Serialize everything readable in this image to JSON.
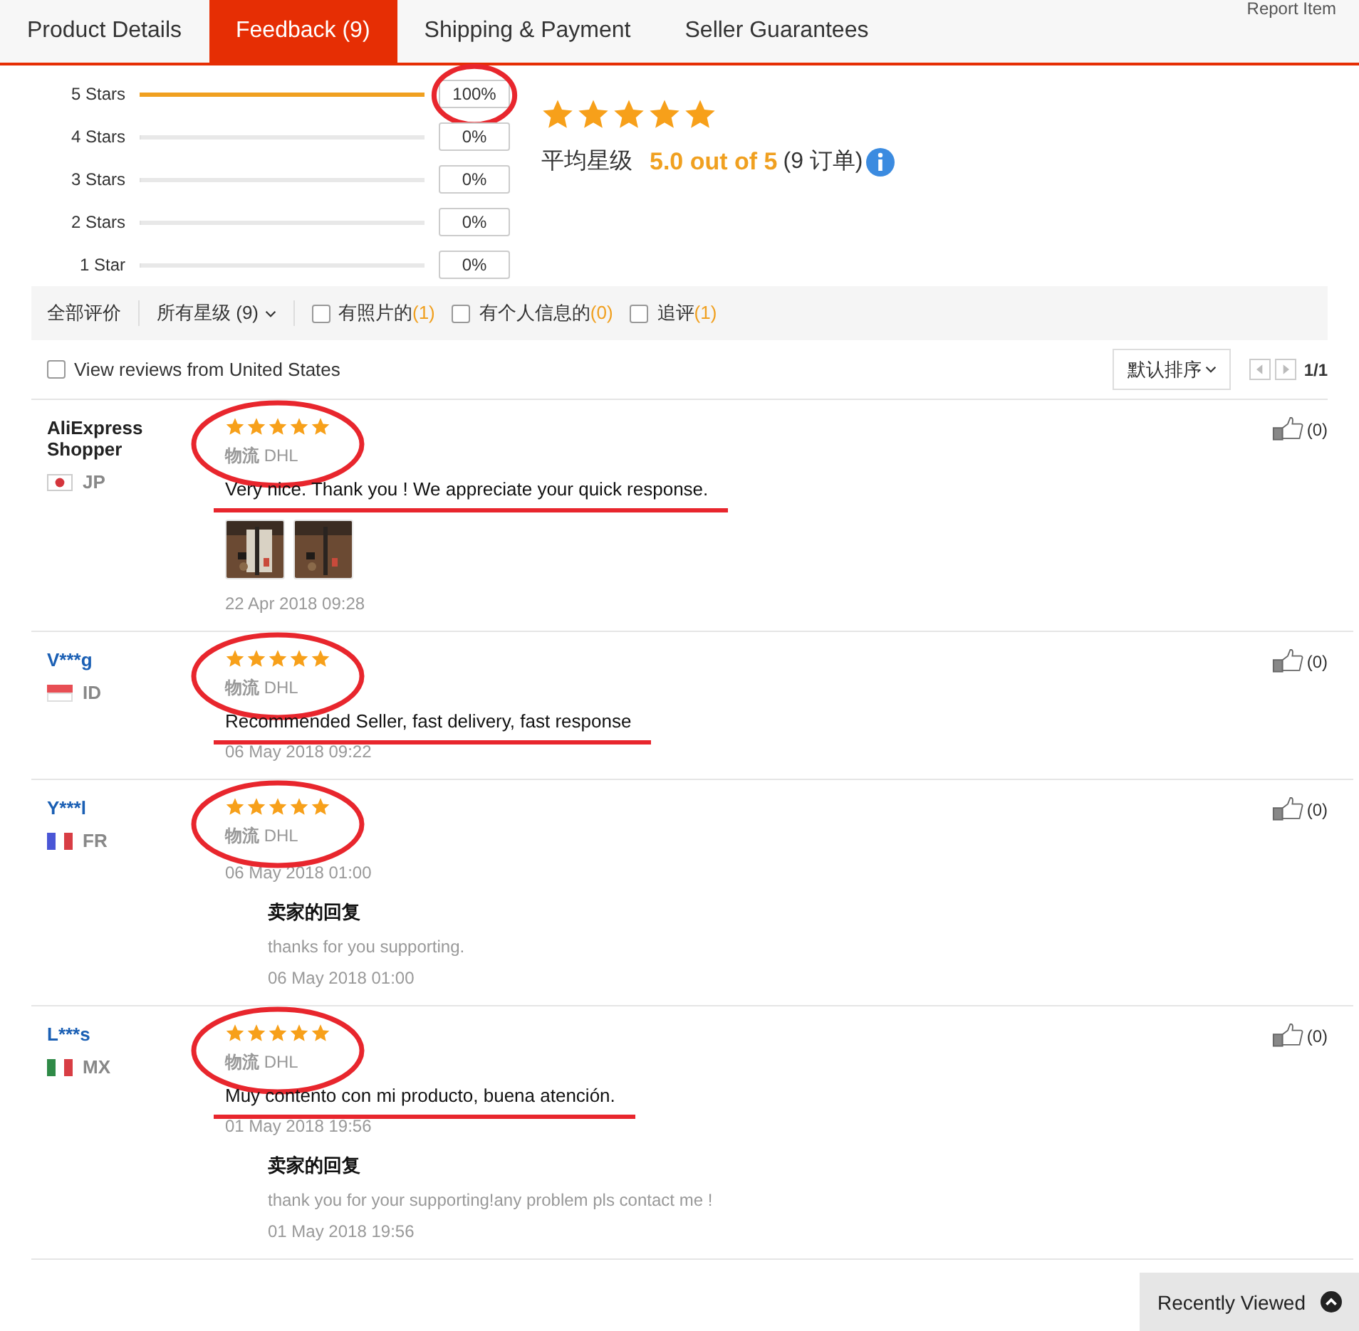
{
  "tabs": [
    {
      "label": "Product Details",
      "selected": false
    },
    {
      "label": "Feedback (9)",
      "selected": true
    },
    {
      "label": "Shipping & Payment",
      "selected": false
    },
    {
      "label": "Seller Guarantees",
      "selected": false
    }
  ],
  "report_link": "Report Item",
  "rating_breakdown": [
    {
      "label": "5 Stars",
      "level": 1,
      "percent": "100%",
      "annotated": true
    },
    {
      "label": "4 Stars",
      "level": 0,
      "percent": "0%",
      "annotated": false
    },
    {
      "label": "3 Stars",
      "level": 0,
      "percent": "0%",
      "annotated": false
    },
    {
      "label": "2 Stars",
      "level": 0,
      "percent": "0%",
      "annotated": false
    },
    {
      "label": "1 Star",
      "level": 0,
      "percent": "0%",
      "annotated": false
    }
  ],
  "summary": {
    "stars": 5,
    "label": "平均星级",
    "score": "5.0 out of 5",
    "orders": "(9 订单)"
  },
  "filters": [
    {
      "kind": "label",
      "text": "全部评价"
    },
    {
      "kind": "dropdown",
      "text": "所有星级 (9)"
    },
    {
      "kind": "checkbox",
      "text": "有照片的",
      "count": "(1)",
      "checked": false
    },
    {
      "kind": "checkbox",
      "text": "有个人信息的",
      "count": "(0)",
      "checked": false
    },
    {
      "kind": "checkbox",
      "text": "追评",
      "count": "(1)",
      "checked": false
    }
  ],
  "country_filter": {
    "label": "View reviews from United States",
    "checked": false
  },
  "sort": "默认排序",
  "pagination": "1/1",
  "reviews": [
    {
      "kind": "anonymous",
      "name": "AliExpress Shopper",
      "flag": {
        "kind": "disc",
        "color": "#d4353c"
      },
      "country": "JP",
      "stars": 5,
      "logistics_label": "物流",
      "logistics": "DHL",
      "text": "Very nice. Thank you ! We appreciate your quick response.",
      "photos": [
        {
          "kind": "picture"
        },
        {
          "kind": "picture"
        }
      ],
      "date": "22 Apr 2018 09:28",
      "likes": "(0)",
      "annotated": true
    },
    {
      "kind": "buyer",
      "name": "V***g",
      "flag": {
        "kind": "bands",
        "color": "#e84e54"
      },
      "country": "ID",
      "stars": 5,
      "logistics_label": "物流",
      "logistics": "DHL",
      "text": "Recommended Seller, fast delivery, fast response",
      "date": "06 May 2018 09:22",
      "likes": "(0)",
      "annotated": true
    },
    {
      "kind": "buyer",
      "name": "Y***l",
      "flag": {
        "kind": "stripes",
        "color": "#4a56d6"
      },
      "country": "FR",
      "stars": 5,
      "logistics_label": "物流",
      "logistics": "DHL",
      "date": "06 May 2018 01:00",
      "likes": "(0)",
      "annotated": true,
      "reply": {
        "title": "卖家的回复",
        "text": "thanks for you supporting.",
        "date": "06 May 2018 01:00"
      }
    },
    {
      "kind": "buyer",
      "name": "L***s",
      "flag": {
        "kind": "stripes",
        "color": "#2f8a47"
      },
      "country": "MX",
      "stars": 5,
      "logistics_label": "物流",
      "logistics": "DHL",
      "text": "Muy contento con mi producto, buena atención.",
      "date": "01 May 2018 19:56",
      "likes": "(0)",
      "annotated": true,
      "reply": {
        "title": "卖家的回复",
        "text": "thank you for your supporting!any problem pls contact me !",
        "date": "01 May 2018 19:56"
      }
    }
  ],
  "recently_viewed": "Recently Viewed"
}
